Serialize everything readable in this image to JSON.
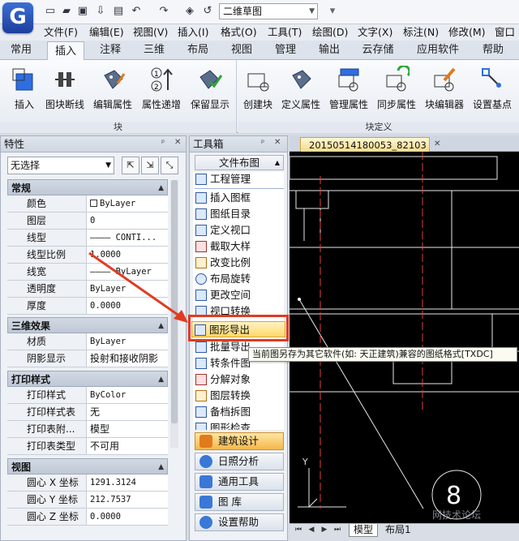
{
  "app": {
    "logo_letter": "G",
    "document_dropdown": "二维草图"
  },
  "menubar": [
    "文件(F)",
    "编辑(E)",
    "视图(V)",
    "插入(I)",
    "格式(O)",
    "工具(T)",
    "绘图(D)",
    "文字(X)",
    "标注(N)",
    "修改(M)",
    "窗口"
  ],
  "tabs": [
    "常用",
    "插入",
    "注释",
    "三维",
    "布局",
    "视图",
    "管理",
    "输出",
    "云存储",
    "应用软件",
    "帮助"
  ],
  "active_tab": "插入",
  "ribbon": {
    "group1": {
      "label": "块",
      "buttons": [
        "插入",
        "图块断线",
        "编辑属性",
        "属性递增",
        "保留显示"
      ]
    },
    "group2": {
      "label": "块定义",
      "buttons": [
        "创建块",
        "定义属性",
        "管理属性",
        "同步属性",
        "块编辑器",
        "设置基点"
      ]
    }
  },
  "properties": {
    "title": "特性",
    "selection": "无选择",
    "sections": [
      {
        "name": "常规",
        "rows": [
          {
            "k": "颜色",
            "v": "ByLayer"
          },
          {
            "k": "图层",
            "v": "0"
          },
          {
            "k": "线型",
            "v": "———— CONTI..."
          },
          {
            "k": "线型比例",
            "v": "1.0000"
          },
          {
            "k": "线宽",
            "v": "———— ByLayer"
          },
          {
            "k": "透明度",
            "v": "ByLayer"
          },
          {
            "k": "厚度",
            "v": "0.0000"
          }
        ]
      },
      {
        "name": "三维效果",
        "rows": [
          {
            "k": "材质",
            "v": "ByLayer"
          },
          {
            "k": "阴影显示",
            "v": "投射和接收阴影"
          }
        ]
      },
      {
        "name": "打印样式",
        "rows": [
          {
            "k": "打印样式",
            "v": "ByColor"
          },
          {
            "k": "打印样式表",
            "v": "无"
          },
          {
            "k": "打印表附...",
            "v": "模型"
          },
          {
            "k": "打印表类型",
            "v": "不可用"
          }
        ]
      },
      {
        "name": "视图",
        "rows": [
          {
            "k": "圆心 X 坐标",
            "v": "1291.3124"
          },
          {
            "k": "圆心 Y 坐标",
            "v": "212.7537"
          },
          {
            "k": "圆心 Z 坐标",
            "v": "0.0000"
          }
        ]
      }
    ]
  },
  "toolbox": {
    "title": "工具箱",
    "category": "文件布图",
    "items": [
      "工程管理",
      "插入图框",
      "图纸目录",
      "定义视口",
      "截取大样",
      "改变比例",
      "布局旋转",
      "更改空间",
      "视口转换",
      "图形导出",
      "批量导出",
      "转条件图",
      "分解对象",
      "图层转换",
      "备档拆图",
      "图形检查"
    ],
    "highlighted": "图形导出",
    "tooltip": "当前图另存为其它软件(如: 天正建筑)兼容的图纸格式[TXDC]",
    "categories": [
      "建筑设计",
      "日照分析",
      "通用工具",
      "图  库",
      "设置帮助"
    ]
  },
  "drawing": {
    "tab": "20150514180053_82103",
    "layout_tabs": [
      "模型",
      "布局1"
    ],
    "active_layout": "模型",
    "circle_label": "8",
    "watermark": "网技术论坛",
    "axis_label": "Y"
  }
}
